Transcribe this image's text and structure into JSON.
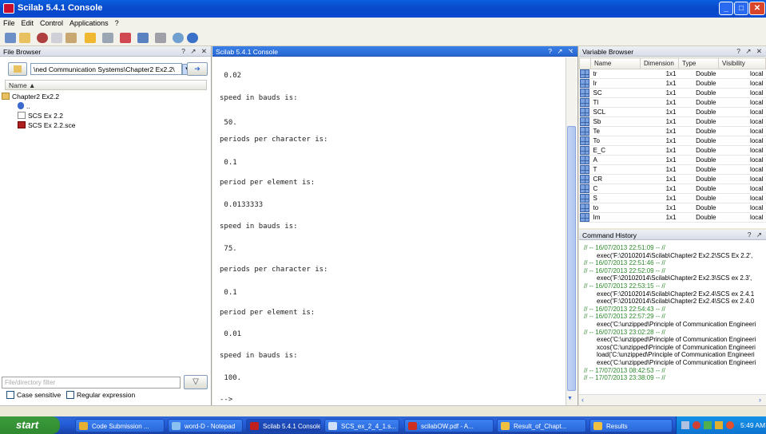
{
  "window": {
    "title": "Scilab 5.4.1 Console"
  },
  "menu": [
    "File",
    "Edit",
    "Control",
    "Applications",
    "?"
  ],
  "file_browser": {
    "title": "File Browser",
    "path": "\\ned Communication Systems\\Chapter2 Ex2.2\\",
    "column": "Name",
    "tree": [
      {
        "label": "Chapter2 Ex2.2",
        "kind": "folder"
      },
      {
        "label": "..",
        "kind": "up"
      },
      {
        "label": "SCS Ex 2.2",
        "kind": "file"
      },
      {
        "label": "SCS Ex 2.2.sce",
        "kind": "sce"
      }
    ],
    "filter_placeholder": "File/directory filter",
    "case_sensitive": "Case sensitive",
    "regular_expression": "Regular expression"
  },
  "console": {
    "title": "Scilab 5.4.1 Console",
    "lines": [
      " 0.02",
      "speed in bauds is:",
      " 50.",
      "periods per character is:",
      " 0.1",
      "period per element is:",
      " 0.0133333",
      "speed in bauds is:",
      " 75.",
      "periods per character is:",
      " 0.1",
      "period per element is:",
      " 0.01",
      "speed in bauds is:",
      " 100."
    ],
    "prompt": "-->"
  },
  "variable_browser": {
    "title": "Variable Browser",
    "columns": [
      "Name",
      "Dimension",
      "Type",
      "Visibility"
    ],
    "rows": [
      [
        "tr",
        "1x1",
        "Double",
        "local"
      ],
      [
        "Ir",
        "1x1",
        "Double",
        "local"
      ],
      [
        "SC",
        "1x1",
        "Double",
        "local"
      ],
      [
        "Tl",
        "1x1",
        "Double",
        "local"
      ],
      [
        "SCL",
        "1x1",
        "Double",
        "local"
      ],
      [
        "Sb",
        "1x1",
        "Double",
        "local"
      ],
      [
        "Te",
        "1x1",
        "Double",
        "local"
      ],
      [
        "To",
        "1x1",
        "Double",
        "local"
      ],
      [
        "E_C",
        "1x1",
        "Double",
        "local"
      ],
      [
        "A",
        "1x1",
        "Double",
        "local"
      ],
      [
        "T",
        "1x1",
        "Double",
        "local"
      ],
      [
        "CR",
        "1x1",
        "Double",
        "local"
      ],
      [
        "C",
        "1x1",
        "Double",
        "local"
      ],
      [
        "S",
        "1x1",
        "Double",
        "local"
      ],
      [
        "to",
        "1x1",
        "Double",
        "local"
      ],
      [
        "Im",
        "1x1",
        "Double",
        "local"
      ]
    ]
  },
  "command_history": {
    "title": "Command History",
    "lines": [
      {
        "t": "// -- 16/07/2013 22:51:09 -- //",
        "k": "g"
      },
      {
        "t": "exec('F:\\20102014\\Scilab\\Chapter2 Ex2.2\\SCS Ex 2.2',",
        "k": "e"
      },
      {
        "t": "// -- 16/07/2013 22:51:46 -- //",
        "k": "g"
      },
      {
        "t": "// -- 16/07/2013 22:52:09 -- //",
        "k": "g"
      },
      {
        "t": "exec('F:\\20102014\\Scilab\\Chapter2 Ex2.3\\SCS ex 2.3',",
        "k": "e"
      },
      {
        "t": "// -- 16/07/2013 22:53:15 -- //",
        "k": "g"
      },
      {
        "t": "exec('F:\\20102014\\Scilab\\Chapter2 Ex2.4\\SCS ex 2.4.1",
        "k": "e"
      },
      {
        "t": "exec('F:\\20102014\\Scilab\\Chapter2 Ex2.4\\SCS ex 2.4.0",
        "k": "e"
      },
      {
        "t": "// -- 16/07/2013 22:54:43 -- //",
        "k": "g"
      },
      {
        "t": "// -- 16/07/2013 22:57:29 -- //",
        "k": "g"
      },
      {
        "t": "exec('C:\\unzipped\\Principle of Communication Engineeri",
        "k": "e"
      },
      {
        "t": "// -- 16/07/2013 23:02:28 -- //",
        "k": "g"
      },
      {
        "t": "exec('C:\\unzipped\\Principle of Communication Engineeri",
        "k": "e"
      },
      {
        "t": "xcos('C:\\unzipped\\Principle of Communication Engineeri",
        "k": "e"
      },
      {
        "t": "load('C:\\unzipped\\Principle of Communication Engineeri",
        "k": "e"
      },
      {
        "t": "exec('C:\\unzipped\\Principle of Communication Engineeri",
        "k": "e"
      },
      {
        "t": "// -- 17/07/2013 08:42:53 -- //",
        "k": "g"
      },
      {
        "t": "// -- 17/07/2013 23:38:09 -- //",
        "k": "g"
      }
    ]
  },
  "taskbar": {
    "start": "start",
    "tasks": [
      "Code Submission ...",
      "word-D - Notepad",
      "Scilab 5.4.1 Console",
      "SCS_ex_2_4_1.s...",
      "scilabOW.pdf - A...",
      "Result_of_Chapt...",
      "Results"
    ],
    "clock": "5:49 AM"
  }
}
